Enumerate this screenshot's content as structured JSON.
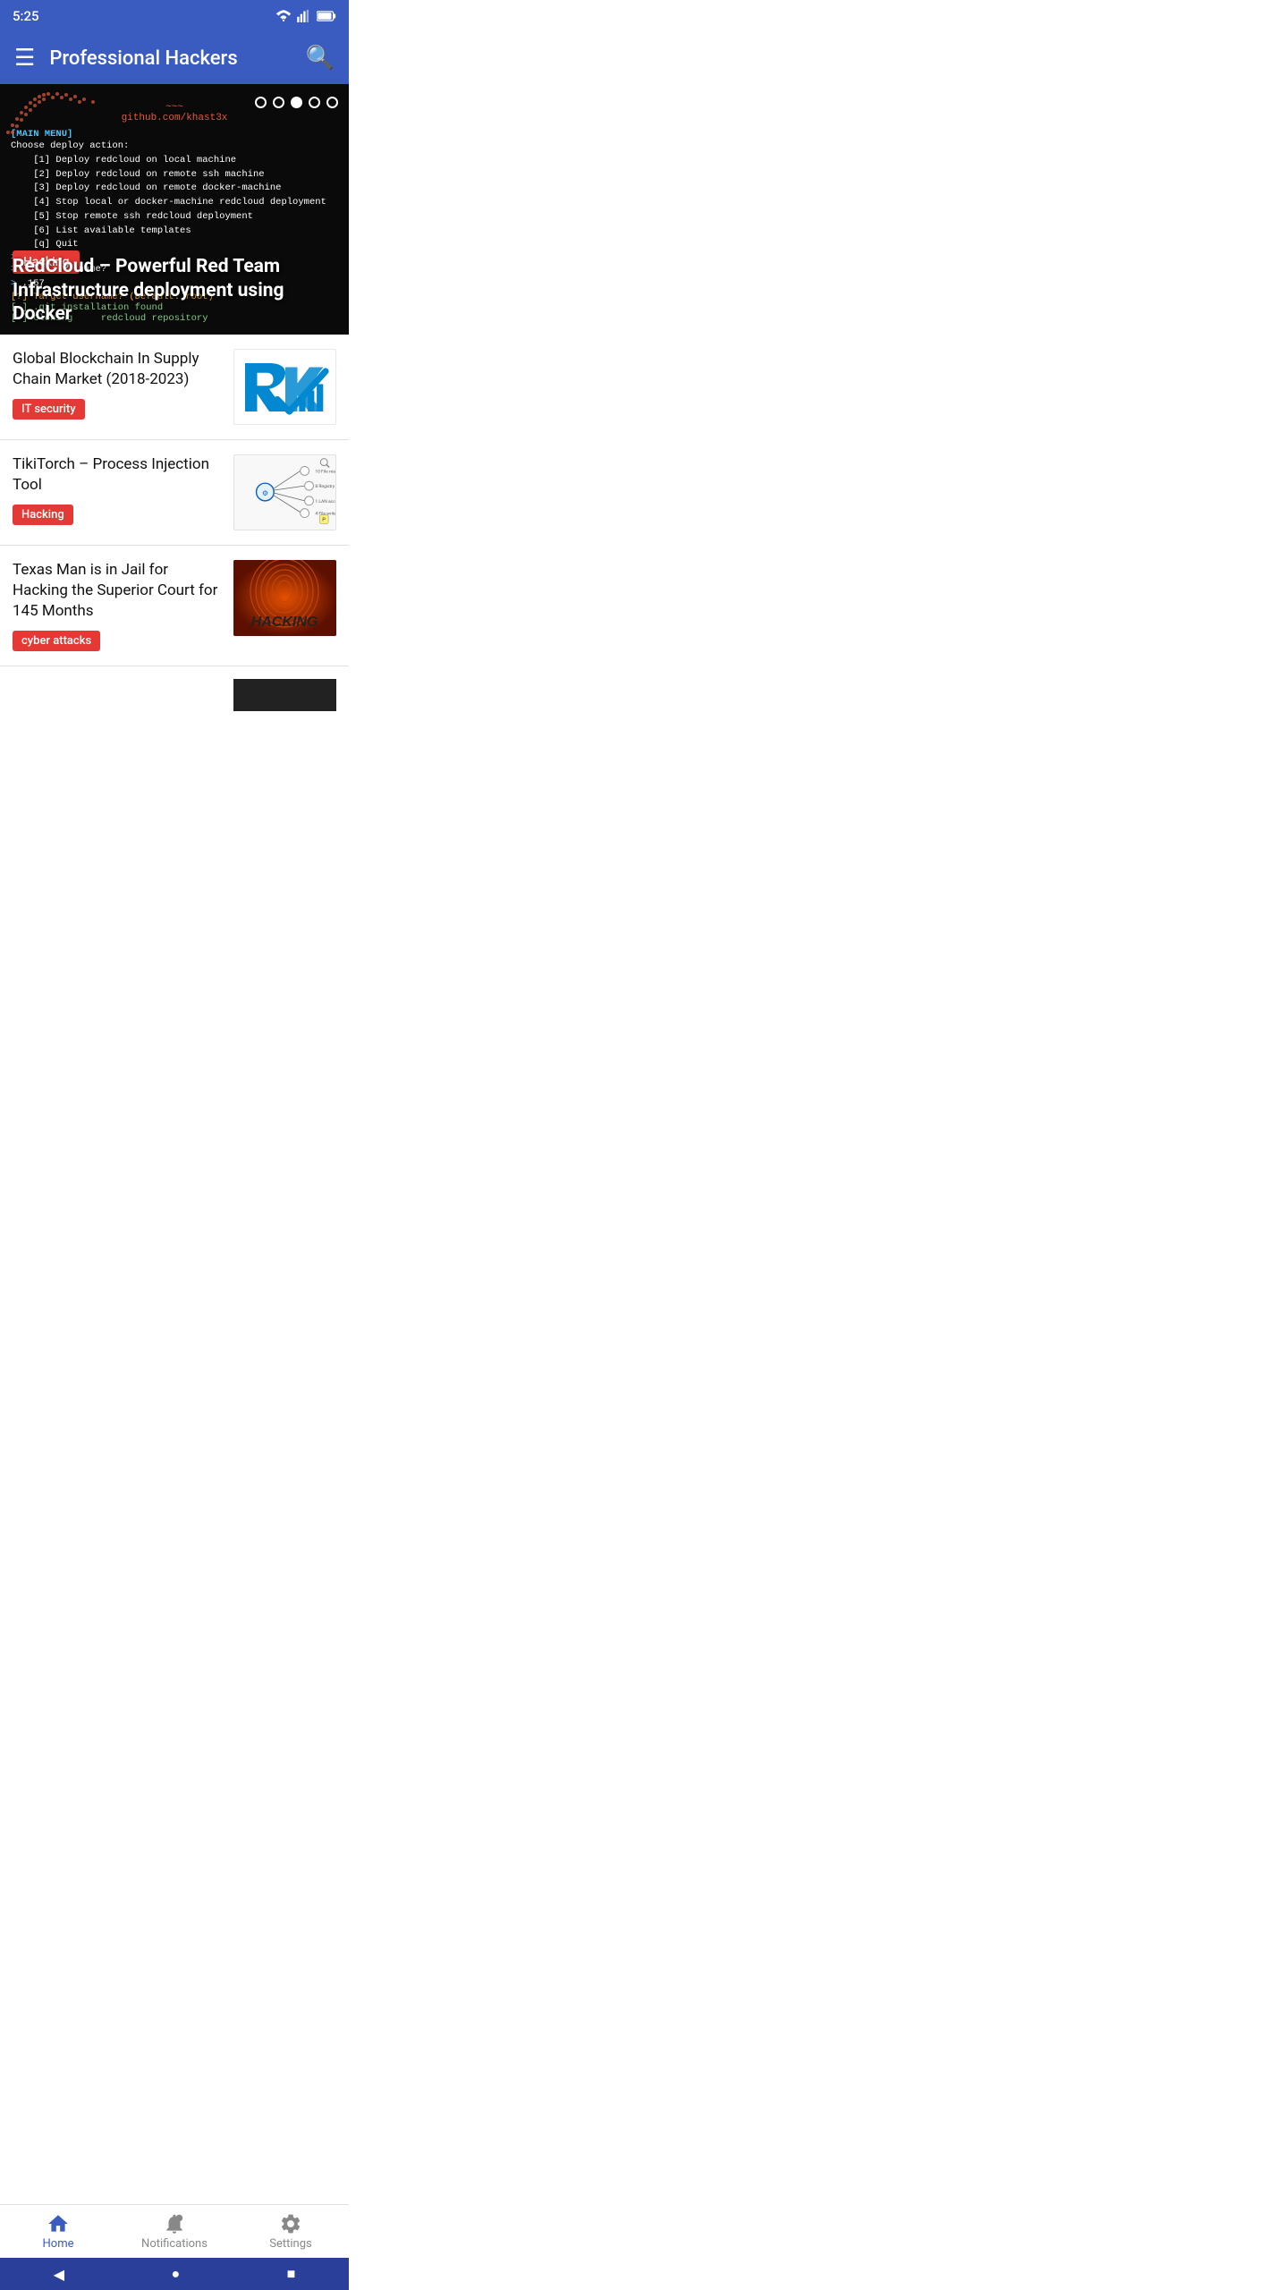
{
  "statusBar": {
    "time": "5:25",
    "wifiIcon": "wifi",
    "signalIcon": "signal",
    "batteryIcon": "battery"
  },
  "appBar": {
    "menuIcon": "menu",
    "title": "Professional Hackers",
    "searchIcon": "search"
  },
  "heroBanner": {
    "githubUrl": "github.com/khast3x",
    "terminalLines": [
      "[MAIN MENU]",
      "Choose deploy action:",
      "    [1] Deploy redcloud on local machine",
      "    [2] Deploy redcloud on remote ssh machine",
      "    [3] Deploy redcloud on remote docker-machine",
      "    [4] Stop local or docker-machine redcloud deployment",
      "    [5] Stop remote ssh redcloud deployment",
      "    [6] List available templates",
      "    [q] Quit",
      ">> 2",
      "> IP or hostname?",
      "> .157",
      "[?] Target username? (Default: root)",
      "[-] .git installation found",
      "[~] Cloning redcloud repository"
    ],
    "category": "Hacking",
    "title": "RedCloud – Powerful Red Team Infrastructure deployment using Docker",
    "dots": [
      false,
      false,
      true,
      false,
      false
    ]
  },
  "articles": [
    {
      "title": "Global Blockchain In Supply Chain Market (2018-2023)",
      "tag": "IT security",
      "tagColor": "#e53935",
      "imageType": "rt-logo"
    },
    {
      "title": "TikiTorch – Process Injection Tool",
      "tag": "Hacking",
      "tagColor": "#e53935",
      "imageType": "tikitorch"
    },
    {
      "title": "Texas Man is in Jail for Hacking the Superior Court for 145 Months",
      "tag": "cyber attacks",
      "tagColor": "#e53935",
      "imageType": "hacking"
    }
  ],
  "bottomNav": [
    {
      "id": "home",
      "label": "Home",
      "active": true,
      "icon": "home"
    },
    {
      "id": "notifications",
      "label": "Notifications",
      "active": false,
      "icon": "notifications"
    },
    {
      "id": "settings",
      "label": "Settings",
      "active": false,
      "icon": "settings"
    }
  ],
  "androidNav": {
    "back": "◀",
    "home": "●",
    "recent": "■"
  }
}
